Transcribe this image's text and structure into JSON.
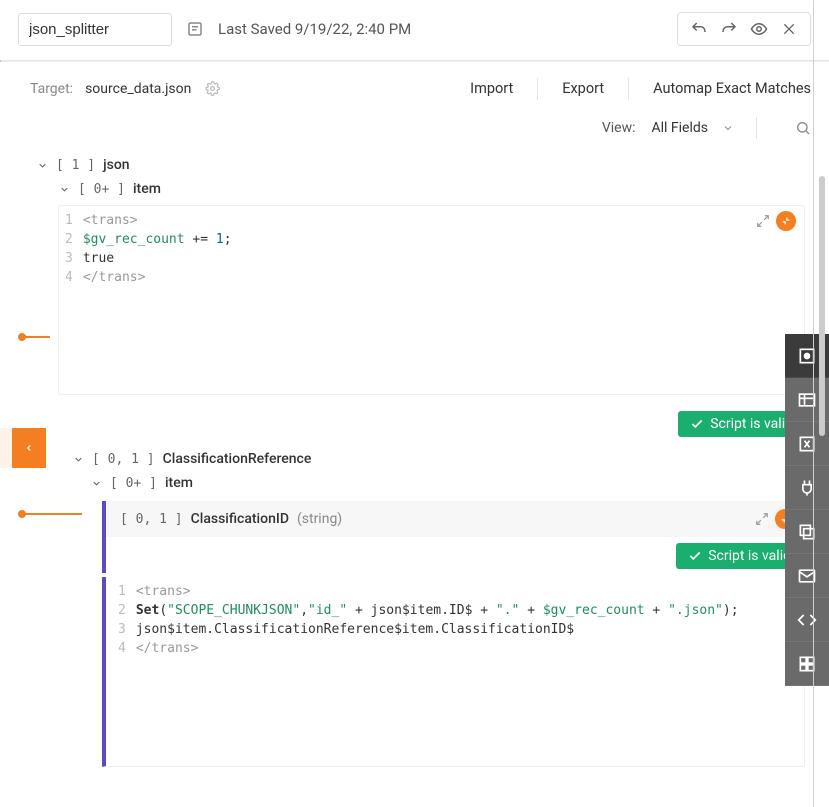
{
  "header": {
    "name": "json_splitter",
    "last_saved": "Last Saved 9/19/22, 2:40 PM"
  },
  "subheader": {
    "target_label": "Target:",
    "target_value": "source_data.json",
    "import": "Import",
    "export": "Export",
    "automap": "Automap Exact Matches"
  },
  "viewbar": {
    "view_label": "View:",
    "view_value": "All Fields"
  },
  "tree": {
    "json": {
      "count": "[ 1 ]",
      "label": "json"
    },
    "item1": {
      "count": "[ 0+ ]",
      "label": "item"
    },
    "classref": {
      "count": "[ 0, 1 ]",
      "label": "ClassificationReference"
    },
    "item2": {
      "count": "[ 0+ ]",
      "label": "item"
    },
    "classid": {
      "count": "[ 0, 1 ]",
      "label": "ClassificationID",
      "type": "(string)"
    }
  },
  "code1": {
    "l1": "<trans>",
    "l2_var": "$gv_rec_count",
    "l2_rest": " += ",
    "l2_num": "1",
    "l2_semi": ";",
    "l3": "true",
    "l4": "</trans>"
  },
  "code2": {
    "l1": "<trans>",
    "l2_kw": "Set",
    "l2_p1": "(",
    "l2_s1": "\"SCOPE_CHUNKJSON\"",
    "l2_c1": ",",
    "l2_s2": "\"id_\"",
    "l2_p2": " + json$item.ID$ + ",
    "l2_s3": "\".\"",
    "l2_p3": " + ",
    "l2_var": "$gv_rec_count",
    "l2_p4": " + ",
    "l2_s4": "\".json\"",
    "l2_end": ");",
    "l3": "json$item.ClassificationReference$item.ClassificationID$",
    "l4": "</trans>"
  },
  "valid_label": "Script is valid"
}
